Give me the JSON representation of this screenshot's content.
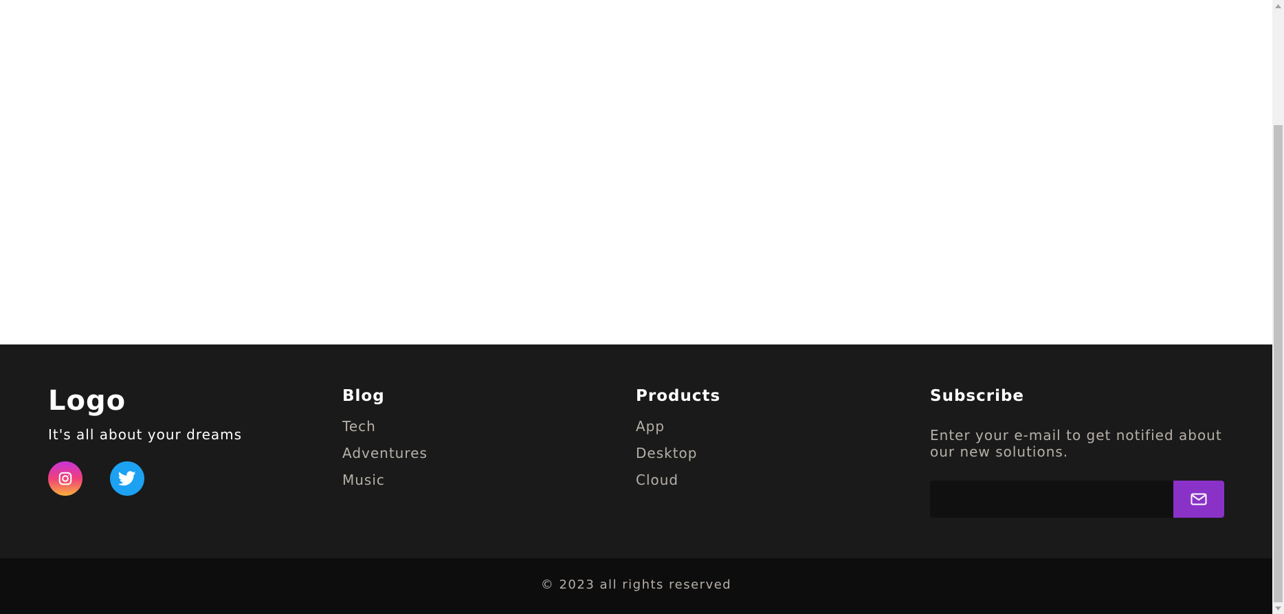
{
  "footer": {
    "brand": {
      "logo": "Logo",
      "tagline": "It's all about your dreams",
      "socials": [
        {
          "icon": "instagram-icon"
        },
        {
          "icon": "twitter-icon"
        }
      ]
    },
    "blog": {
      "heading": "Blog",
      "links": [
        "Tech",
        "Adventures",
        "Music"
      ]
    },
    "products": {
      "heading": "Products",
      "links": [
        "App",
        "Desktop",
        "Cloud"
      ]
    },
    "subscribe": {
      "heading": "Subscribe",
      "text": "Enter your e-mail to get notified about our new solutions.",
      "email_value": "",
      "button_icon": "mail-icon"
    }
  },
  "bottom": {
    "copyright": "© 2023 all rights reserved"
  },
  "colors": {
    "footer_bg": "#1a1a1a",
    "bottom_bg": "#0e0d0e",
    "accent": "#8a32c8",
    "link": "#b6b0a9",
    "twitter": "#1da1f2"
  }
}
